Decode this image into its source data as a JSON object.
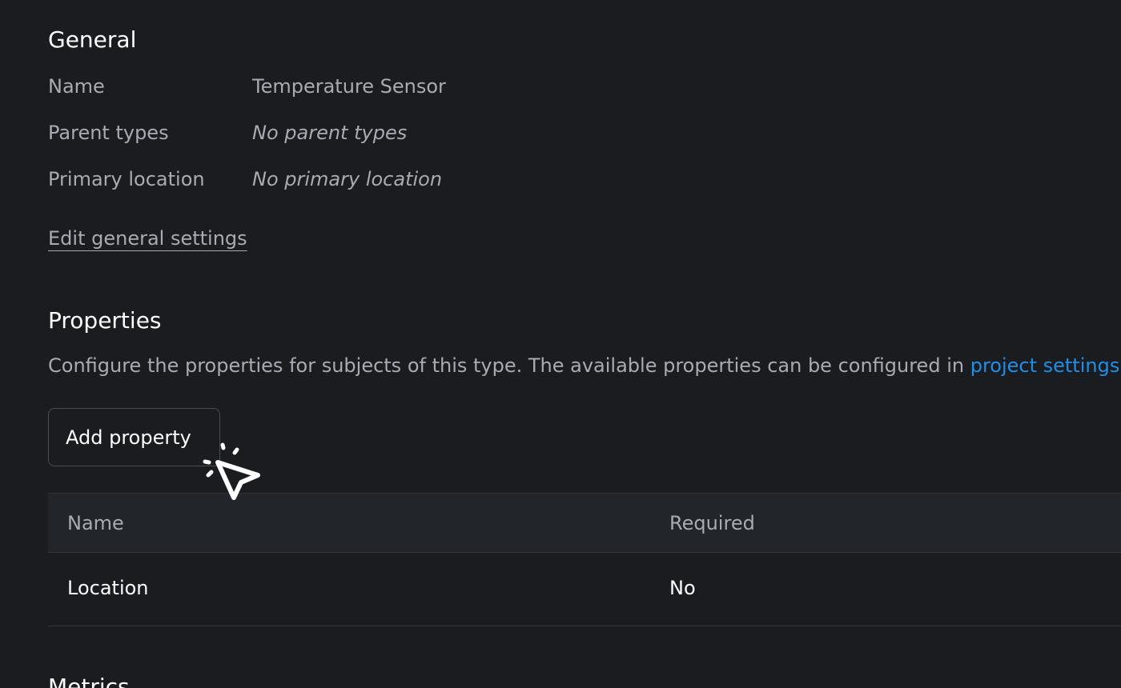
{
  "general": {
    "title": "General",
    "fields": [
      {
        "label": "Name",
        "value": "Temperature Sensor"
      },
      {
        "label": "Parent types",
        "value": "No parent types"
      },
      {
        "label": "Primary location",
        "value": "No primary location"
      }
    ],
    "edit_link": "Edit general settings"
  },
  "properties": {
    "title": "Properties",
    "description": "Configure the properties for subjects of this type. The available properties can be configured in ",
    "description_link": "project settings",
    "add_button": "Add property",
    "table": {
      "headers": [
        "Name",
        "Required"
      ],
      "rows": [
        {
          "name": "Location",
          "required": "No"
        }
      ]
    }
  },
  "metrics": {
    "title": "Metrics"
  },
  "colors": {
    "background": "#1b1c20",
    "muted_text": "#a9abb4",
    "link": "#1e8fe6",
    "table_header_bg": "#22262a"
  },
  "icons": {
    "cursor": "click-cursor-icon"
  }
}
